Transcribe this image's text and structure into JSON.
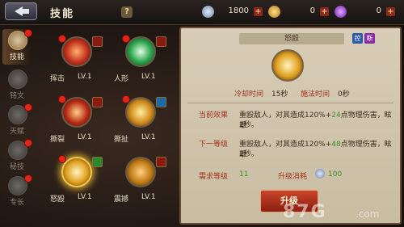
{
  "header": {
    "title": "技能",
    "help": "?"
  },
  "currencies": [
    {
      "name": "diamond",
      "value": "1800",
      "color": "#9fb7d8"
    },
    {
      "name": "gold",
      "value": "0",
      "color": "#e8b22a"
    },
    {
      "name": "gem",
      "value": "0",
      "color": "#9a4ad8"
    }
  ],
  "sidebar": [
    {
      "label": "技能",
      "active": true
    },
    {
      "label": "铭文",
      "active": false
    },
    {
      "label": "天赋",
      "active": false
    },
    {
      "label": "秘技",
      "active": false
    },
    {
      "label": "专长",
      "active": false
    }
  ],
  "skills": [
    {
      "name": "挥击",
      "level": "LV.1",
      "color": "#c0301a"
    },
    {
      "name": "人形",
      "level": "LV.1",
      "color": "#2aa24a"
    },
    {
      "name": "撕裂",
      "level": "LV.1",
      "color": "#b82a14"
    },
    {
      "name": "撕扯",
      "level": "LV.1",
      "color": "#d08a1a"
    },
    {
      "name": "怒殴",
      "level": "LV.1",
      "color": "#e0a020"
    },
    {
      "name": "震撼",
      "level": "LV.1",
      "color": "#c07a14"
    }
  ],
  "detail": {
    "title": "怒殴",
    "tags": [
      "控",
      "断"
    ],
    "cooldown_label": "冷却时间",
    "cooldown": "15秒",
    "cast_label": "施法时间",
    "cast": "0秒",
    "current_label": "当前效果",
    "current_pre": "重殴敌人，对其造成120%+",
    "current_bonus": "24",
    "current_post": "点物理伤害，眩晕",
    "current_line2": "2秒。",
    "next_label": "下一等级",
    "next_pre": "重殴敌人，对其造成120%+",
    "next_bonus": "48",
    "next_post": "点物理伤害，眩晕",
    "next_line2": "2秒。",
    "req_label": "需求等级",
    "req_level": "11",
    "cost_label": "升级消耗",
    "cost": "100",
    "upgrade": "升级"
  },
  "watermark": {
    "brand": "87G",
    "site": ".com"
  }
}
